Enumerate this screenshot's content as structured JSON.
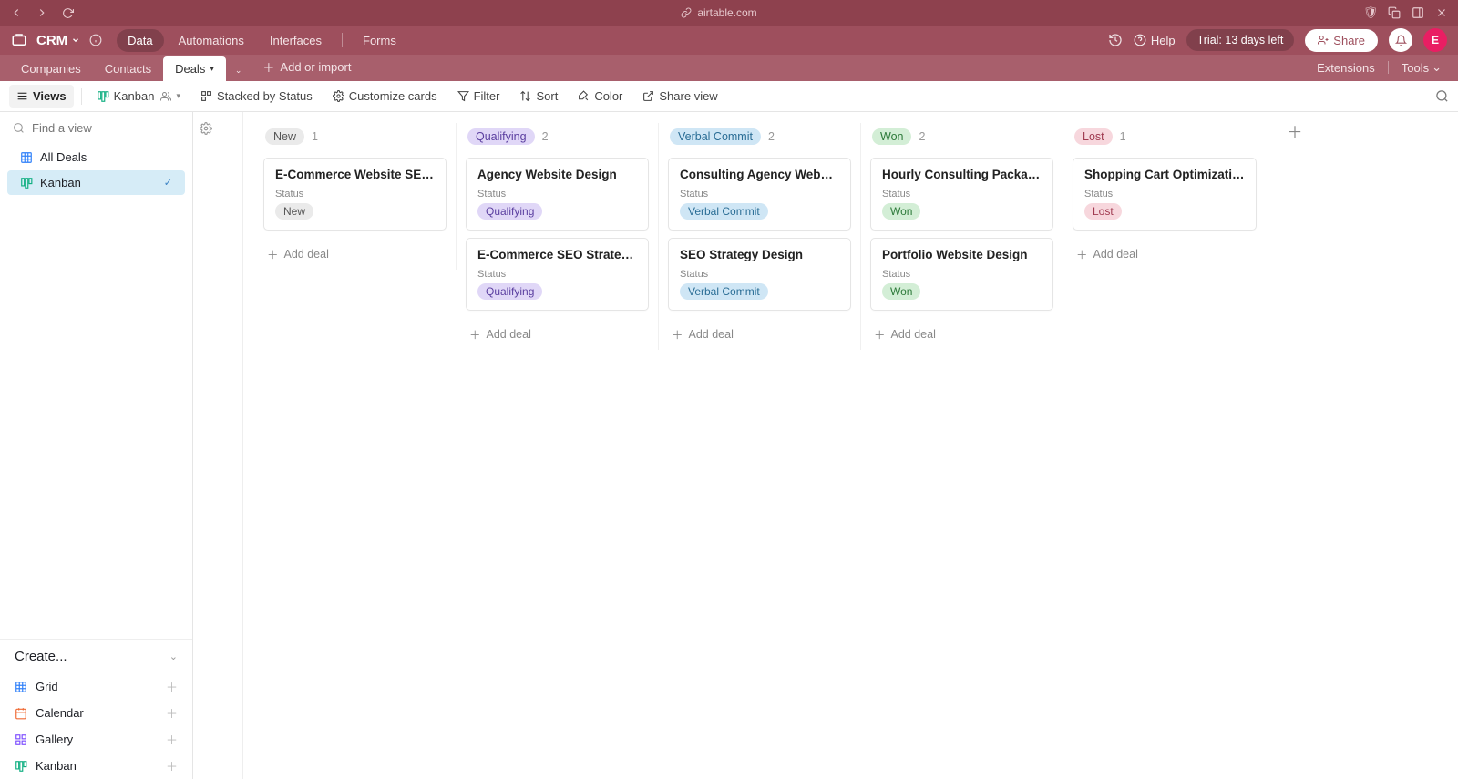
{
  "browser": {
    "url": "airtable.com"
  },
  "app": {
    "title": "CRM",
    "nav": [
      "Data",
      "Automations",
      "Interfaces",
      "Forms"
    ],
    "help": "Help",
    "trial": "Trial: 13 days left",
    "share": "Share",
    "avatar": "E"
  },
  "tabs": {
    "items": [
      "Companies",
      "Contacts",
      "Deals"
    ],
    "add": "Add or import",
    "right": [
      "Extensions",
      "Tools"
    ]
  },
  "toolbar": {
    "views": "Views",
    "kanban": "Kanban",
    "stacked": "Stacked by Status",
    "customize": "Customize cards",
    "filter": "Filter",
    "sort": "Sort",
    "color": "Color",
    "share": "Share view"
  },
  "sidebar": {
    "find_placeholder": "Find a view",
    "views": [
      {
        "icon": "grid",
        "label": "All Deals",
        "active": false
      },
      {
        "icon": "kanban",
        "label": "Kanban",
        "active": true
      }
    ],
    "create": {
      "header": "Create...",
      "items": [
        {
          "icon": "grid",
          "label": "Grid",
          "color": "ic-blue"
        },
        {
          "icon": "calendar",
          "label": "Calendar",
          "color": "ic-orange"
        },
        {
          "icon": "gallery",
          "label": "Gallery",
          "color": "ic-purple"
        },
        {
          "icon": "kanban",
          "label": "Kanban",
          "color": "ic-green"
        }
      ]
    }
  },
  "statusField": "Status",
  "addDeal": "Add deal",
  "columns": [
    {
      "name": "New",
      "badgeClass": "bg-new",
      "count": "1",
      "cards": [
        {
          "title": "E-Commerce Website SEO an...",
          "status": "New",
          "badgeClass": "bg-new"
        }
      ]
    },
    {
      "name": "Qualifying",
      "badgeClass": "bg-qual",
      "count": "2",
      "cards": [
        {
          "title": "Agency Website Design",
          "status": "Qualifying",
          "badgeClass": "bg-qual"
        },
        {
          "title": "E-Commerce SEO Strategy D...",
          "status": "Qualifying",
          "badgeClass": "bg-qual"
        }
      ]
    },
    {
      "name": "Verbal Commit",
      "badgeClass": "bg-verbal",
      "count": "2",
      "cards": [
        {
          "title": "Consulting Agency Website a...",
          "status": "Verbal Commit",
          "badgeClass": "bg-verbal"
        },
        {
          "title": "SEO Strategy Design",
          "status": "Verbal Commit",
          "badgeClass": "bg-verbal"
        }
      ]
    },
    {
      "name": "Won",
      "badgeClass": "bg-won",
      "count": "2",
      "cards": [
        {
          "title": "Hourly Consulting Package",
          "status": "Won",
          "badgeClass": "bg-won"
        },
        {
          "title": "Portfolio Website Design",
          "status": "Won",
          "badgeClass": "bg-won"
        }
      ]
    },
    {
      "name": "Lost",
      "badgeClass": "bg-lost",
      "count": "1",
      "cards": [
        {
          "title": "Shopping Cart Optimization",
          "status": "Lost",
          "badgeClass": "bg-lost"
        }
      ]
    }
  ]
}
